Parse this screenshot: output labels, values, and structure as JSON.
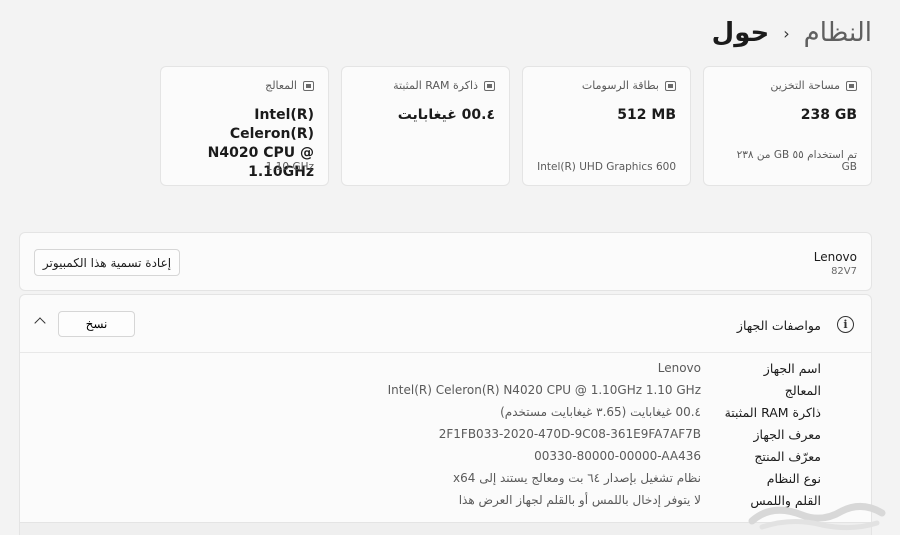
{
  "breadcrumb": {
    "parent": "النظام",
    "separator": "›",
    "current": "حول"
  },
  "cards": [
    {
      "title": "مساحة التخزين",
      "icon": "storage-icon",
      "value": "238 GB",
      "footer": "تم استخدام ٥٥ GB من ٢٣٨ GB"
    },
    {
      "title": "بطاقة الرسومات",
      "icon": "gpu-icon",
      "value": "512 MB",
      "footer": "Intel(R) UHD Graphics 600"
    },
    {
      "title": "ذاكرة RAM المثبتة",
      "icon": "ram-icon",
      "value": "٤.00 غيغابايت",
      "footer": ""
    },
    {
      "title": "المعالج",
      "icon": "cpu-icon",
      "value": "Intel(R) Celeron(R) N4020 CPU @ 1.10GHz",
      "footer": "1.10 GHz"
    }
  ],
  "device": {
    "name": "Lenovo",
    "model": "82V7",
    "rename_label": "إعادة تسمية هذا الكمبيوتر"
  },
  "specs": {
    "title": "مواصفات الجهاز",
    "copy_label": "نسخ",
    "rows": [
      {
        "label": "اسم الجهاز",
        "value": "Lenovo"
      },
      {
        "label": "المعالج",
        "value": "Intel(R) Celeron(R) N4020 CPU @ 1.10GHz   1.10 GHz"
      },
      {
        "label": "ذاكرة RAM المثبتة",
        "value": "٤.00 غيغابايت (٣.65 غيغابايت مستخدم)"
      },
      {
        "label": "معرف الجهاز",
        "value": "2F1FB033-2020-470D-9C08-361E9FA7AF7B"
      },
      {
        "label": "معرّف المنتج",
        "value": "00330-80000-00000-AA436"
      },
      {
        "label": "نوع النظام",
        "value": "نظام تشغيل بإصدار ٦٤ بت ومعالج يستند إلى x64"
      },
      {
        "label": "القلم واللمس",
        "value": "لا يتوفر إدخال باللمس أو بالقلم لجهاز العرض هذا"
      }
    ]
  },
  "colors": {
    "background": "#f3f3f3",
    "card": "#fbfbfb",
    "border": "#e4e4e4"
  }
}
